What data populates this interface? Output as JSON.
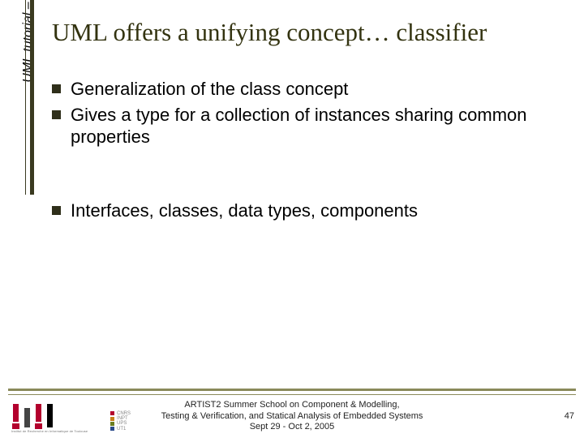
{
  "sidebar_text": "UML tutorial – Ileana Ober",
  "title": "UML offers a unifying concept… classifier",
  "bullets_a": [
    "Generalization of the class concept",
    "Gives a type for a collection of instances sharing common properties"
  ],
  "bullets_b": [
    "Interfaces, classes, data types, components"
  ],
  "logo": {
    "subtitle": "Institut de Recherche en Informatique de Toulouse",
    "depts": [
      "CNRS",
      "INPT",
      "UPS",
      "UT1"
    ]
  },
  "footer": {
    "line1": "ARTIST2 Summer School on Component & Modelling,",
    "line2": "Testing & Verification, and Statical Analysis of Embedded Systems",
    "line3": "Sept 29 - Oct 2, 2005"
  },
  "page": "47"
}
